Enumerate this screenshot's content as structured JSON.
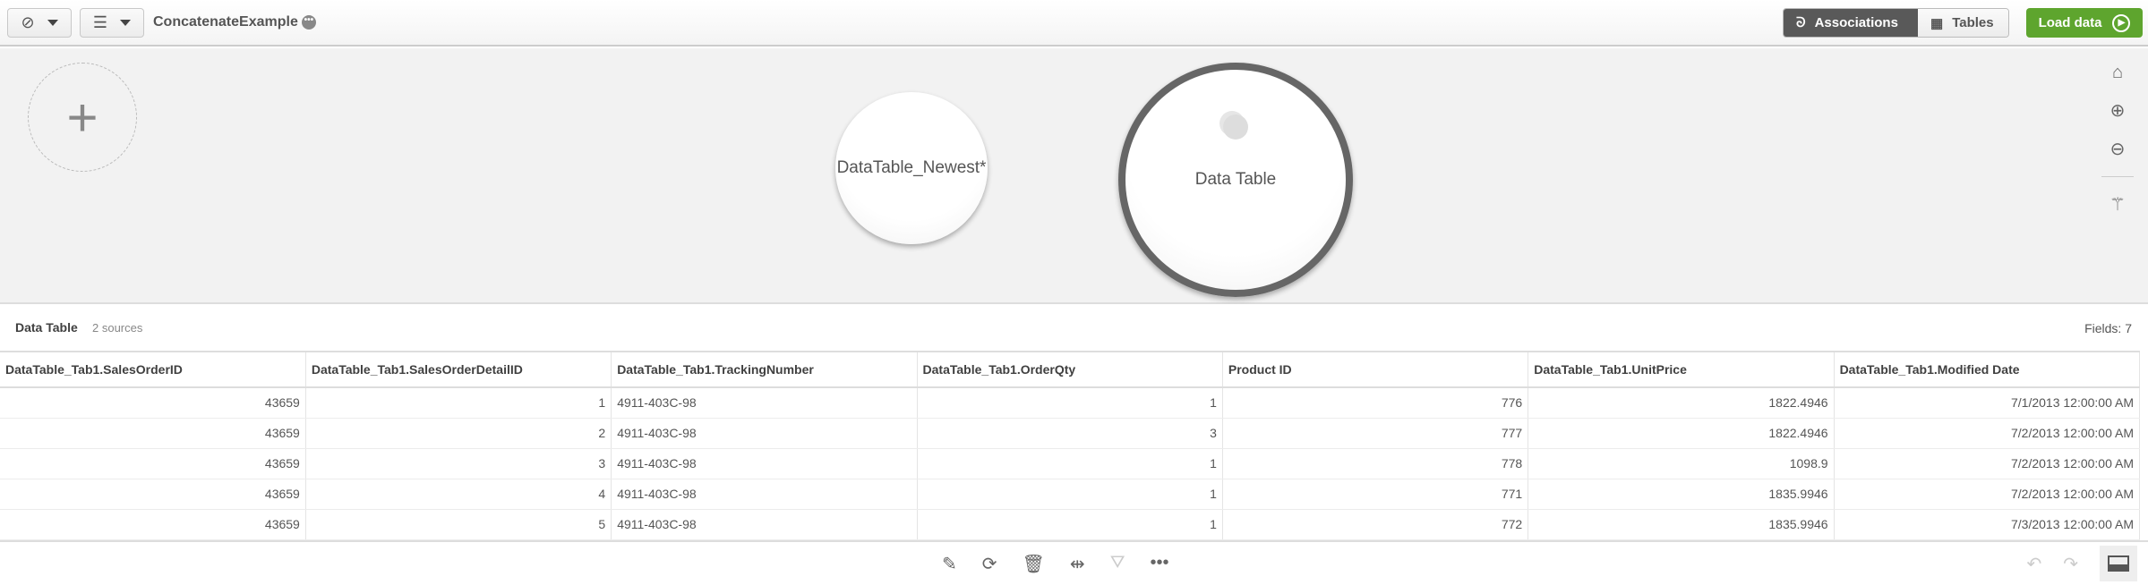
{
  "header": {
    "app_title": "ConcatenateExample",
    "views": {
      "associations": "Associations",
      "tables": "Tables"
    },
    "load_data": "Load data"
  },
  "canvas": {
    "tables": [
      "DataTable_Newest*",
      "Data Table"
    ],
    "add_symbol": "+"
  },
  "table_info": {
    "title": "Data Table",
    "sources": "2 sources",
    "fields": "Fields: 7"
  },
  "table": {
    "columns": [
      "DataTable_Tab1.SalesOrderID",
      "DataTable_Tab1.SalesOrderDetailID",
      "DataTable_Tab1.TrackingNumber",
      "DataTable_Tab1.OrderQty",
      "Product ID",
      "DataTable_Tab1.UnitPrice",
      "DataTable_Tab1.Modified Date"
    ],
    "rows": [
      [
        "43659",
        "1",
        "4911-403C-98",
        "1",
        "776",
        "1822.4946",
        "7/1/2013 12:00:00 AM"
      ],
      [
        "43659",
        "2",
        "4911-403C-98",
        "3",
        "777",
        "1822.4946",
        "7/2/2013 12:00:00 AM"
      ],
      [
        "43659",
        "3",
        "4911-403C-98",
        "1",
        "778",
        "1098.9",
        "7/2/2013 12:00:00 AM"
      ],
      [
        "43659",
        "4",
        "4911-403C-98",
        "1",
        "771",
        "1835.9946",
        "7/2/2013 12:00:00 AM"
      ],
      [
        "43659",
        "5",
        "4911-403C-98",
        "1",
        "772",
        "1835.9946",
        "7/3/2013 12:00:00 AM"
      ]
    ]
  },
  "colors": {
    "accent": "#5ea52e",
    "active_seg": "#595959"
  }
}
